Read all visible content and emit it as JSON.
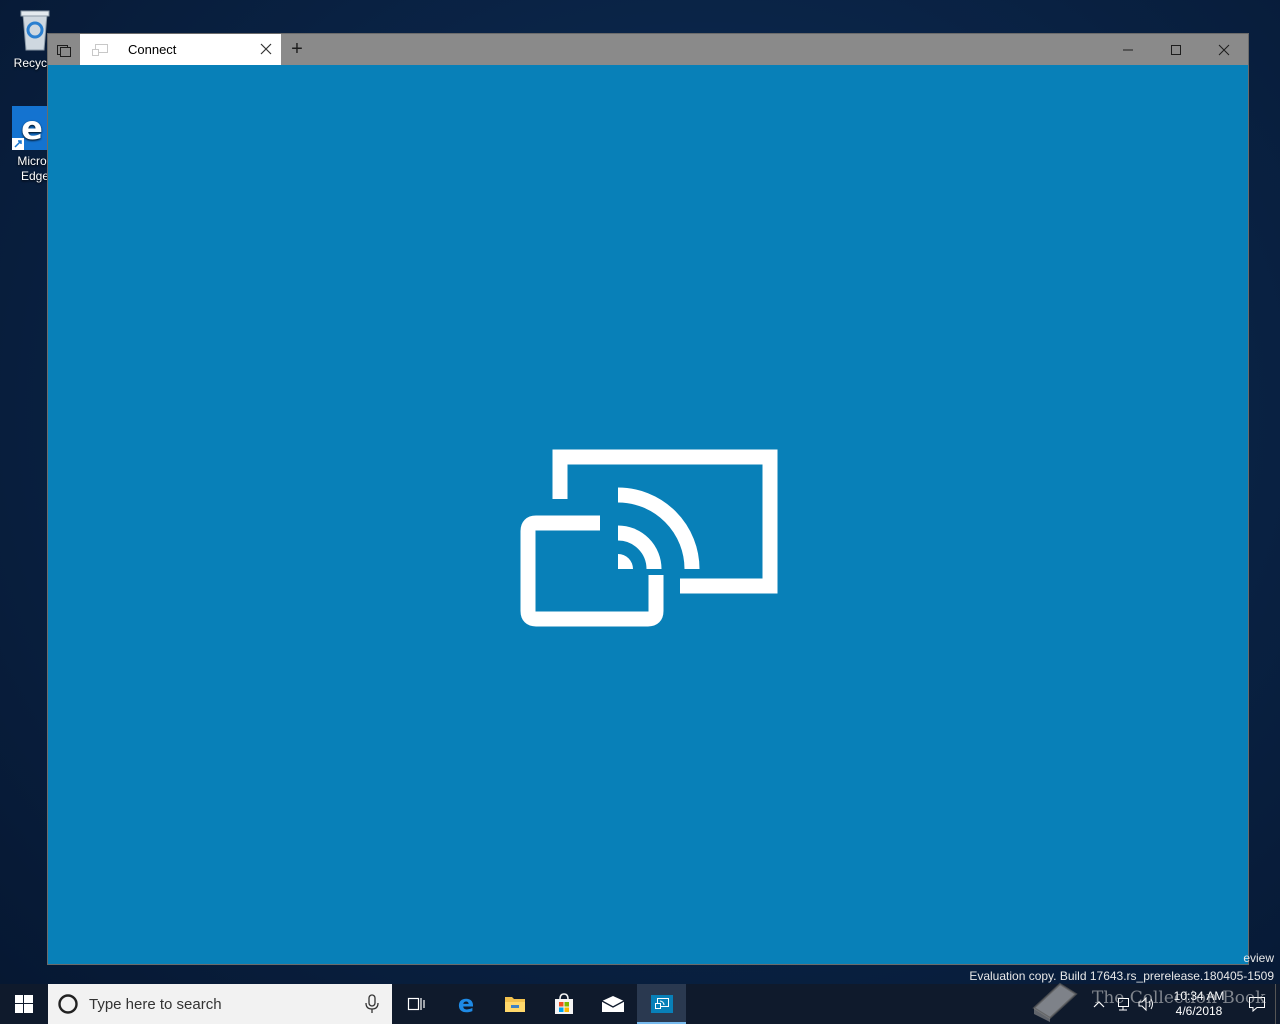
{
  "desktop": {
    "icons": [
      {
        "label": "Recycle"
      },
      {
        "label_line1": "Micros",
        "label_line2": "Edge"
      }
    ]
  },
  "window": {
    "tab_title": "Connect",
    "new_tab_symbol": "+",
    "hero_icon": "cast-to-device-icon"
  },
  "watermark": {
    "line1": "eview",
    "line2": "Evaluation copy. Build 17643.rs_prerelease.180405-1509"
  },
  "taskbar": {
    "search_placeholder": "Type here to search",
    "time": "10:34 AM",
    "date": "4/6/2018",
    "brand_text": "The Collection Book"
  },
  "colors": {
    "app_background": "#0880b8",
    "titlebar": "#8a8a8a",
    "taskbar": "#0f1a2c"
  }
}
